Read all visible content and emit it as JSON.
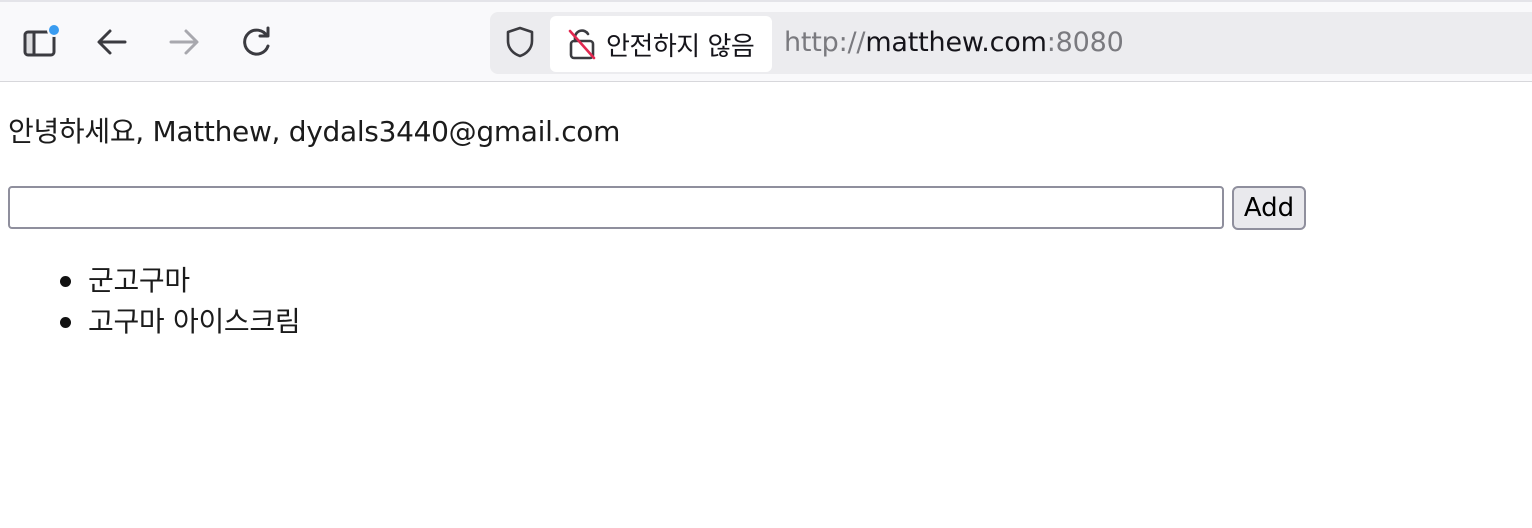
{
  "browser": {
    "security_label": "안전하지 않음",
    "url_scheme": "http://",
    "url_host": "matthew.com",
    "url_port": ":8080",
    "icons": {
      "sidebar": "sidebar-icon",
      "back": "arrow-left-icon",
      "forward": "arrow-right-icon",
      "reload": "reload-icon",
      "shield": "shield-icon",
      "lock": "insecure-lock-icon"
    },
    "colors": {
      "sidebar_dot": "#3a9cf0",
      "insecure_slash": "#e22850"
    }
  },
  "page": {
    "greeting": "안녕하세요, Matthew, dydals3440@gmail.com",
    "input_value": "",
    "add_label": "Add",
    "items": [
      {
        "text": "군고구마"
      },
      {
        "text": "고구마 아이스크림"
      }
    ]
  }
}
